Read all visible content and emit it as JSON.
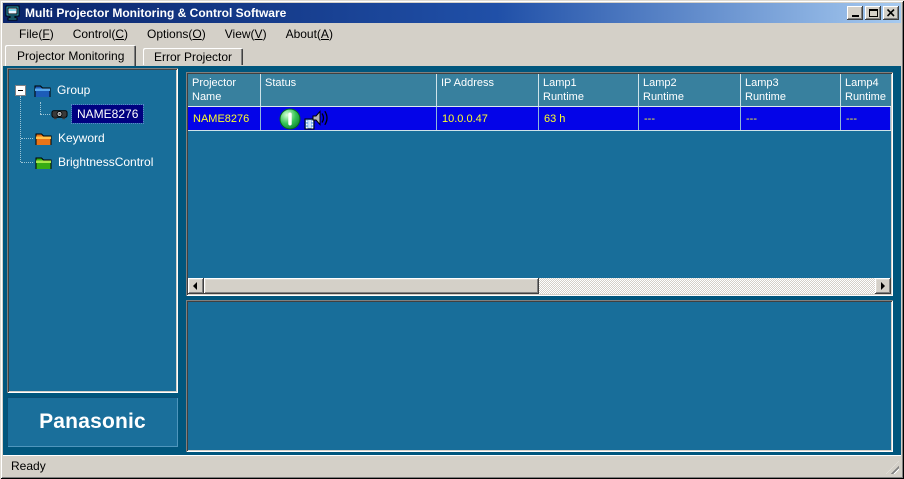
{
  "window": {
    "title": "Multi Projector Monitoring & Control Software",
    "controls": {
      "minimize": "minimize",
      "maximize": "maximize",
      "close": "close"
    }
  },
  "menu": {
    "items": [
      {
        "label": "File(F)"
      },
      {
        "label": "Control(C)"
      },
      {
        "label": "Options(O)"
      },
      {
        "label": "View(V)"
      },
      {
        "label": "About(A)"
      }
    ]
  },
  "tabs": [
    {
      "label": "Projector Monitoring",
      "active": true
    },
    {
      "label": "Error Projector",
      "active": false
    }
  ],
  "tree": {
    "items": [
      {
        "label": "Group",
        "icon": "folder-blue-icon",
        "expanded": true,
        "level": 0
      },
      {
        "label": "NAME8276",
        "icon": "projector-icon",
        "selected": true,
        "level": 1
      },
      {
        "label": "Keyword",
        "icon": "folder-orange-icon",
        "level": 0
      },
      {
        "label": "BrightnessControl",
        "icon": "folder-green-icon",
        "level": 0
      }
    ]
  },
  "logo": {
    "text": "Panasonic"
  },
  "table": {
    "columns": [
      {
        "line1": "Projector",
        "line2": "Name"
      },
      {
        "line1": "Status",
        "line2": ""
      },
      {
        "line1": "IP Address",
        "line2": ""
      },
      {
        "line1": "Lamp1",
        "line2": "Runtime"
      },
      {
        "line1": "Lamp2",
        "line2": "Runtime"
      },
      {
        "line1": "Lamp3",
        "line2": "Runtime"
      },
      {
        "line1": "Lamp4",
        "line2": "Runtime"
      }
    ],
    "rows": [
      {
        "name": "NAME8276",
        "status_icons": [
          "power-on-icon",
          "speaker-icon"
        ],
        "ip": "10.0.0.47",
        "lamp1": "63 h",
        "lamp2": "---",
        "lamp3": "---",
        "lamp4": "---"
      }
    ]
  },
  "statusbar": {
    "text": "Ready"
  },
  "colors": {
    "titlebar_left": "#0a246a",
    "titlebar_right": "#a6caf0",
    "chrome": "#d4d0c8",
    "client_bg": "#00567d",
    "panel_teal": "#186e9a",
    "header_teal": "#38809e",
    "row_blue": "#0404e8",
    "row_text_yellow": "#ffff28",
    "selected_navy": "#000080",
    "tree_text": "#ffffff"
  }
}
